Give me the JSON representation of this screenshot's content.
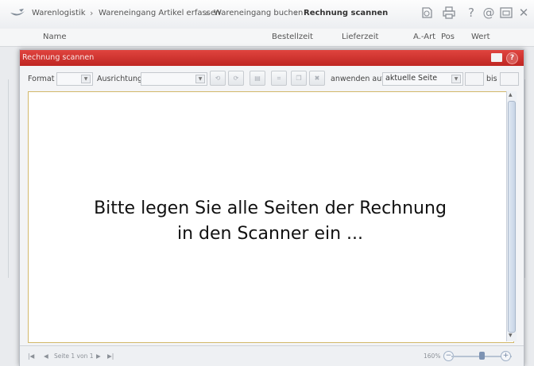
{
  "breadcrumb": {
    "items": [
      "Warenlogistik",
      "Wareneingang Artikel erfassen",
      "Wareneingang buchen",
      "Rechnung scannen"
    ],
    "separator": "›"
  },
  "top_icons": [
    "history-icon",
    "print-icon",
    "help-icon",
    "at-icon",
    "window-icon",
    "close-icon"
  ],
  "top_icon_glyphs": {
    "help": "?",
    "at": "@",
    "close": "✕"
  },
  "table_headers": {
    "name": "Name",
    "bestellzeit": "Bestellzeit",
    "lieferzeit": "Lieferzeit",
    "a_art": "A.-Art",
    "pos": "Pos",
    "wert": "Wert"
  },
  "dialog": {
    "title": "Rechnung scannen",
    "help_glyph": "?",
    "toolbar": {
      "format_label": "Format",
      "format_value": "",
      "ausrichtung_label": "Ausrichtung",
      "ausrichtung_value": "",
      "anwenden_label": "anwenden auf",
      "anwenden_value": "aktuelle Seite",
      "bis_label": "bis"
    },
    "message_line1": "Bitte legen Sie alle Seiten der Rechnung",
    "message_line2": "in den Scanner ein ...",
    "footer": {
      "page_text": "Seite 1 von 1",
      "zoom_text": "160%",
      "zoom_level_fraction": 0.6
    }
  },
  "colors": {
    "titlebar": "#c9302c",
    "document_border": "#d2b86a"
  }
}
